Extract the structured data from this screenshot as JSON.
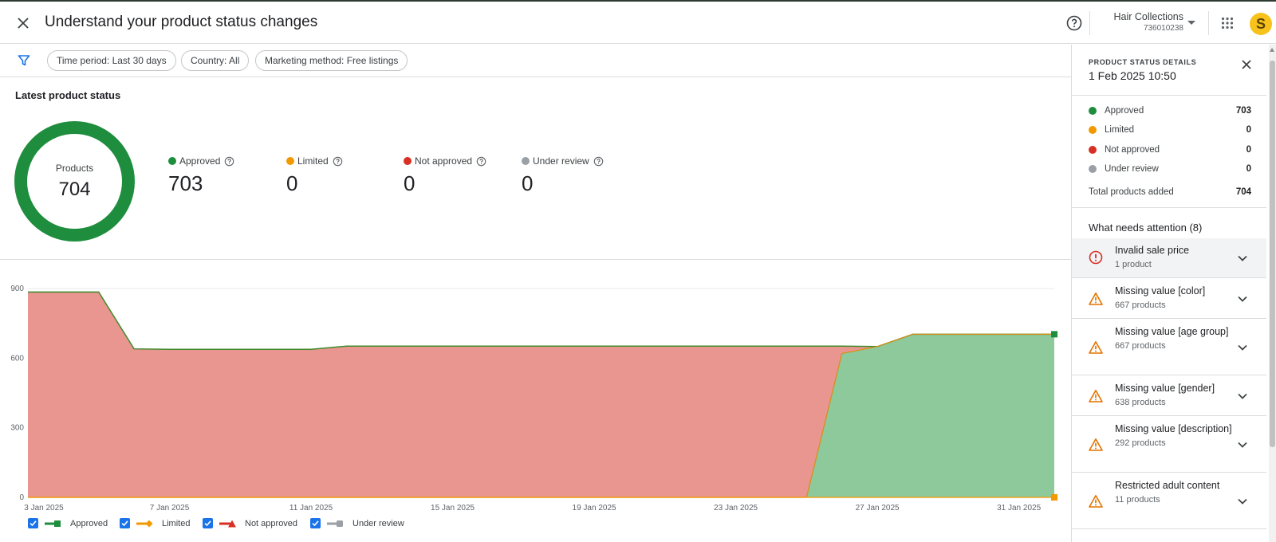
{
  "header": {
    "title": "Understand your product status changes",
    "account_name": "Hair Collections",
    "account_id": "736010238",
    "avatar_letter": "S",
    "icons": [
      "close-icon",
      "help-icon",
      "caret-down-icon",
      "apps-grid-icon"
    ]
  },
  "filters": {
    "chips": [
      "Time period: Last 30 days",
      "Country: All",
      "Marketing method: Free listings"
    ]
  },
  "latest": {
    "title": "Latest product status",
    "donut_label": "Products",
    "donut_value": "704",
    "stats": [
      {
        "label": "Approved",
        "value": "703",
        "color": "#1e8e3e"
      },
      {
        "label": "Limited",
        "value": "0",
        "color": "#f29900"
      },
      {
        "label": "Not approved",
        "value": "0",
        "color": "#d93025"
      },
      {
        "label": "Under review",
        "value": "0",
        "color": "#9aa0a6"
      }
    ]
  },
  "chart_data": {
    "type": "area",
    "title": "",
    "xlabel": "",
    "ylabel": "",
    "ylim": [
      0,
      900
    ],
    "yticks": [
      "0",
      "300",
      "600",
      "900"
    ],
    "xticks": [
      "3 Jan 2025",
      "7 Jan 2025",
      "11 Jan 2025",
      "15 Jan 2025",
      "19 Jan 2025",
      "23 Jan 2025",
      "27 Jan 2025",
      "31 Jan 2025"
    ],
    "x": [
      "2025-01-03",
      "2025-01-05",
      "2025-01-06",
      "2025-01-07",
      "2025-01-11",
      "2025-01-12",
      "2025-01-25",
      "2025-01-26",
      "2025-01-27",
      "2025-01-28",
      "2025-02-01"
    ],
    "series": [
      {
        "name": "Approved",
        "color": "#1e8e3e",
        "values": [
          0,
          0,
          0,
          0,
          0,
          0,
          0,
          620,
          650,
          703,
          703
        ]
      },
      {
        "name": "Limited",
        "color": "#f29900",
        "values": [
          0,
          0,
          0,
          0,
          0,
          0,
          0,
          0,
          0,
          0,
          0
        ]
      },
      {
        "name": "Not approved",
        "color": "#d93025",
        "values": [
          885,
          885,
          640,
          638,
          638,
          652,
          652,
          32,
          0,
          0,
          0
        ]
      },
      {
        "name": "Under review",
        "color": "#9aa0a6",
        "values": [
          0,
          0,
          0,
          0,
          0,
          0,
          0,
          0,
          0,
          0,
          0
        ]
      }
    ],
    "grid": true,
    "legend_position": "bottom"
  },
  "legend": {
    "items": [
      "Approved",
      "Limited",
      "Not approved",
      "Under review"
    ]
  },
  "panel": {
    "kicker": "PRODUCT STATUS DETAILS",
    "date": "1 Feb 2025 10:50",
    "stats": [
      {
        "label": "Approved",
        "value": "703",
        "color": "#1e8e3e"
      },
      {
        "label": "Limited",
        "value": "0",
        "color": "#f29900"
      },
      {
        "label": "Not approved",
        "value": "0",
        "color": "#d93025"
      },
      {
        "label": "Under review",
        "value": "0",
        "color": "#9aa0a6"
      }
    ],
    "total_label": "Total products added",
    "total_value": "704",
    "attention_title": "What needs attention (8)",
    "issues": [
      {
        "title": "Invalid sale price",
        "count": "1 product",
        "icon": "error-icon"
      },
      {
        "title": "Missing value [color]",
        "count": "667 products",
        "icon": "warning-icon"
      },
      {
        "title": "Missing value [age group]",
        "count": "667 products",
        "icon": "warning-icon"
      },
      {
        "title": "Missing value [gender]",
        "count": "638 products",
        "icon": "warning-icon"
      },
      {
        "title": "Missing value [description]",
        "count": "292 products",
        "icon": "warning-icon"
      },
      {
        "title": "Restricted adult content",
        "count": "11 products",
        "icon": "warning-icon"
      }
    ]
  }
}
